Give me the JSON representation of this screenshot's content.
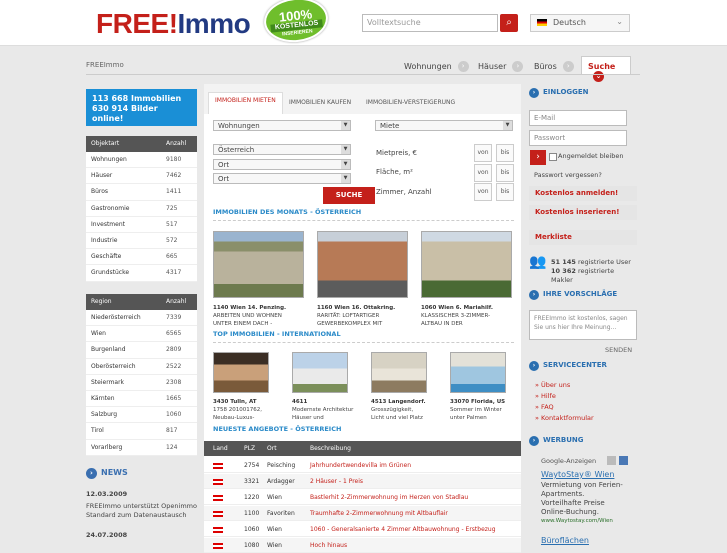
{
  "header": {
    "logo_a": "FREE",
    "logo_b": "!",
    "logo_c": "Immo",
    "badge_pct": "100%",
    "badge_k": "KOSTENLOS",
    "badge_i": "INSERIEREN",
    "search_placeholder": "Volltextsuche",
    "lang": "Deutsch"
  },
  "crumb": "FREEImmo",
  "nav": {
    "wohnungen": "Wohnungen",
    "haeuser": "Häuser",
    "bueros": "Büros",
    "suche": "Suche"
  },
  "stats": {
    "line1": "113 668  Immobilien",
    "line2": "630 914  Bilder online!"
  },
  "objektart": {
    "h1": "Objektart",
    "h2": "Anzahl",
    "rows": [
      [
        "Wohnungen",
        "9180"
      ],
      [
        "Häuser",
        "7462"
      ],
      [
        "Büros",
        "1411"
      ],
      [
        "Gastronomie",
        "725"
      ],
      [
        "Investment",
        "517"
      ],
      [
        "Industrie",
        "572"
      ],
      [
        "Geschäfte",
        "665"
      ],
      [
        "Grundstücke",
        "4317"
      ]
    ]
  },
  "region": {
    "h1": "Region",
    "h2": "Anzahl",
    "rows": [
      [
        "Niederösterreich",
        "7339"
      ],
      [
        "Wien",
        "6565"
      ],
      [
        "Burgenland",
        "2809"
      ],
      [
        "Oberösterreich",
        "2522"
      ],
      [
        "Steiermark",
        "2308"
      ],
      [
        "Kärnten",
        "1665"
      ],
      [
        "Salzburg",
        "1060"
      ],
      [
        "Tirol",
        "817"
      ],
      [
        "Vorarlberg",
        "124"
      ]
    ]
  },
  "news": {
    "title": "NEWS",
    "d1": "12.03.2009",
    "t1a": "FREEImmo unterstützt Openimmo",
    "t1b": "Standard zum Datenaustausch",
    "d2": "24.07.2008"
  },
  "tabs": {
    "t1": "IMMOBILIEN MIETEN",
    "t2": "IMMOBILIEN KAUFEN",
    "t3": "IMMOBILIEN-VERSTEIGERUNG"
  },
  "form": {
    "typ": "Wohnungen",
    "miete": "Miete",
    "land": "Österreich",
    "ort1": "Ort",
    "ort2": "Ort",
    "mietpreis": "Mietpreis, €",
    "flaeche": "Fläche, m²",
    "zimmer": "Zimmer, Anzahl",
    "von": "von",
    "bis": "bis",
    "suche": "SUCHE"
  },
  "monat": {
    "title": "IMMOBILIEN DES MONATS - ÖSTERREICH",
    "items": [
      {
        "h": "1140 Wien 14. Penzing.",
        "l1": "ARBEITEN UND WOHNEN",
        "l2": "UNTER EINEM DACH -"
      },
      {
        "h": "1160 Wien 16. Ottakring.",
        "l1": "RARITÄT: LOFTARTIGER",
        "l2": "GEWERBEKOMPLEX MIT"
      },
      {
        "h": "1060 Wien 6. Mariahilf.",
        "l1": "KLASSISCHER 3-ZIMMER-",
        "l2": "ALTBAU IN DER"
      }
    ]
  },
  "top": {
    "title": "TOP IMMOBILIEN - INTERNATIONAL",
    "items": [
      {
        "h": "3430 Tulln, AT",
        "l1": "1758 201001762,",
        "l2": "Neubau-Luxus-"
      },
      {
        "h": "4611",
        "l1": "Modernste Architektur",
        "l2": "Häuser und"
      },
      {
        "h": "4513 Langendorf.",
        "l1": "Grosszügigkeit,",
        "l2": "Licht und viel Platz"
      },
      {
        "h": "33070 Florida, US",
        "l1": "Sommer im Winter",
        "l2": "unter Palmen"
      }
    ]
  },
  "neu": {
    "title": "NEUESTE ANGEBOTE - ÖSTERREICH",
    "h_land": "Land",
    "h_plz": "PLZ",
    "h_ort": "Ort",
    "h_desc": "Beschreibung",
    "rows": [
      [
        "2754",
        "Peisching",
        "Jahrhundertwendevilla im Grünen"
      ],
      [
        "3321",
        "Ardagger",
        "2 Häuser - 1 Preis"
      ],
      [
        "1220",
        "Wien",
        "Bastlerhit 2-Zimmerwohnung im Herzen von Stadlau"
      ],
      [
        "1100",
        "Favoriten",
        "Traumhafte 2-Zimmerwohnung mit Altbauflair"
      ],
      [
        "1060",
        "Wien",
        "1060 - Generalsanierte 4 Zimmer Altbauwohnung - Erstbezug"
      ],
      [
        "1080",
        "Wien",
        "Hoch hinaus"
      ]
    ]
  },
  "login": {
    "title": "EINLOGGEN",
    "email": "E-Mail",
    "pw": "Passwort",
    "remember": "Angemeldet bleiben",
    "forgot": "Passwort vergessen?",
    "anmelden": "Kostenlos anmelden!",
    "inserieren": "Kostenlos inserieren!",
    "merkliste": "Merkliste"
  },
  "users": {
    "n1": "51 145",
    "t1": "registrierte User",
    "n2": "10 362",
    "t2": "registrierte Makler"
  },
  "vorschlaege": {
    "title": "IHRE VORSCHLÄGE",
    "text": "FREEImmo ist kostenlos, sagen Sie uns hier Ihre Meinung...",
    "senden": "SENDEN"
  },
  "service": {
    "title": "SERVICECENTER",
    "l1": "Über uns",
    "l2": "Hilfe",
    "l3": "FAQ",
    "l4": "Kontaktformular"
  },
  "werbung": {
    "title": "WERBUNG",
    "google": "Google-Anzeigen",
    "ad_title": "WaytoStay® Wien",
    "ad1": "Vermietung von Ferien-",
    "ad2": "Apartments.",
    "ad3": "Vorteilhafte Preise",
    "ad4": "Online-Buchung.",
    "ad_url": "www.Waytostay.com/Wien",
    "next": "Büroflächen"
  }
}
